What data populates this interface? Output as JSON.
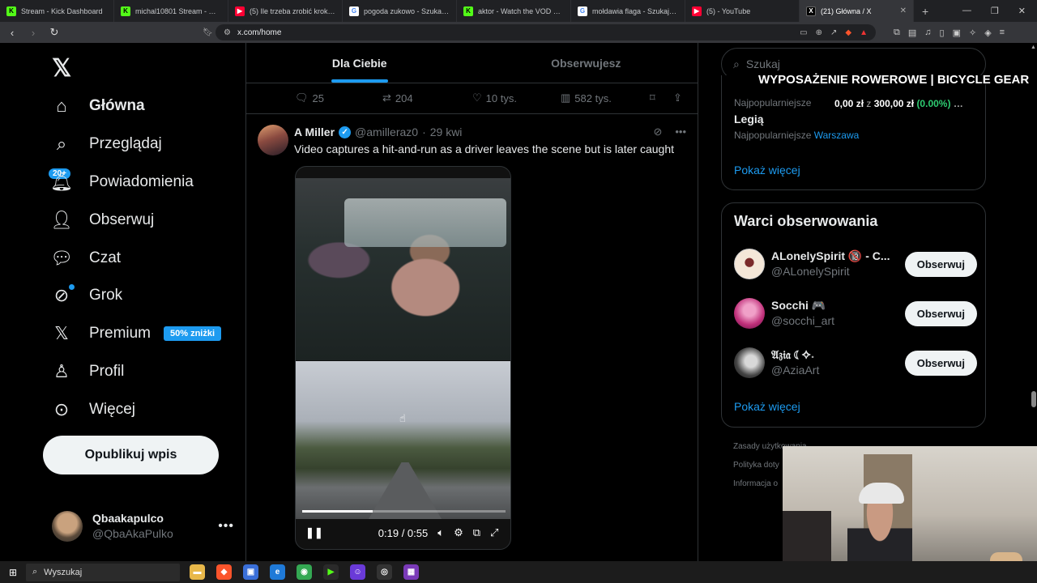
{
  "browser": {
    "tabs": [
      {
        "title": "Stream - Kick Dashboard",
        "fav": "K",
        "color": "#53fc18"
      },
      {
        "title": "michal10801 Stream - Watch Liv",
        "fav": "K",
        "color": "#53fc18"
      },
      {
        "title": "(5) Ile trzeba zrobić kroków, żeb",
        "fav": "▶",
        "color": "#ff0033"
      },
      {
        "title": "pogoda zukowo - Szukaj w Go",
        "fav": "G",
        "color": "#4285f4"
      },
      {
        "title": "aktor - Watch the VOD on Kick",
        "fav": "K",
        "color": "#53fc18"
      },
      {
        "title": "mołdawia flaga - Szukaj w Goo",
        "fav": "G",
        "color": "#4285f4"
      },
      {
        "title": "(5) - YouTube",
        "fav": "▶",
        "color": "#ff0033"
      },
      {
        "title": "(21) Główna / X",
        "fav": "X",
        "color": "#000000",
        "active": true
      }
    ],
    "url": "x.com/home"
  },
  "sidebar": {
    "items": [
      {
        "label": "Główna",
        "icon": "home-icon"
      },
      {
        "label": "Przeglądaj",
        "icon": "search-icon"
      },
      {
        "label": "Powiadomienia",
        "icon": "bell-icon"
      },
      {
        "label": "Obserwuj",
        "icon": "follow-icon"
      },
      {
        "label": "Czat",
        "icon": "chat-icon"
      },
      {
        "label": "Grok",
        "icon": "grok-icon"
      },
      {
        "label": "Premium",
        "icon": "x-icon"
      },
      {
        "label": "Profil",
        "icon": "profile-icon"
      },
      {
        "label": "Więcej",
        "icon": "more-icon"
      }
    ],
    "notif_badge": "20+",
    "premium_badge": "50% zniżki",
    "post_button": "Opublikuj wpis",
    "profile": {
      "name": "Qbaakapulco",
      "handle": "@QbaAkaPulko"
    }
  },
  "feed": {
    "tabs": [
      "Dla Ciebie",
      "Obserwujesz"
    ],
    "prev_actions": {
      "replies": "25",
      "reposts": "204",
      "likes": "10 tys.",
      "views": "582 tys."
    },
    "tweet": {
      "name": "A Miller",
      "handle": "@amilleraz0",
      "time": "29 kwi",
      "text": "Video captures a hit-and-run as a driver leaves the scene but is later caught",
      "video_time": "0:19 / 0:55",
      "progress": 0.345
    }
  },
  "right": {
    "search_placeholder": "Szukaj",
    "stream_overlay": "WYPOSAŻENIE ROWEROWE | BICYCLE GEAR",
    "trend": {
      "row1": "Najpopularniejsze",
      "ticker": "0,00 zł",
      "ticker_z": "z",
      "ticker_goal": "300,00 zł",
      "ticker_pct": "(0.00%)",
      "name": "Legią",
      "row2_prefix": "Najpopularniejsze",
      "row2_link": "Warszawa"
    },
    "show_more": "Pokaż więcej",
    "who_to_follow": {
      "title": "Warci obserwowania",
      "accounts": [
        {
          "name": "ALonelySpirit 🔞 - C...",
          "handle": "@ALonelySpirit"
        },
        {
          "name": "Socchi 🎮",
          "handle": "@socchi_art"
        },
        {
          "name": "𝔄𝔷𝔦𝔞 ☾✧˖",
          "handle": "@AziaArt"
        }
      ],
      "follow_label": "Obserwuj",
      "show_more": "Pokaż więcej"
    },
    "footer": [
      "Zasady użytkowania",
      "Polityka doty",
      "Informacja o"
    ]
  },
  "taskbar": {
    "search": "Wyszukaj"
  }
}
